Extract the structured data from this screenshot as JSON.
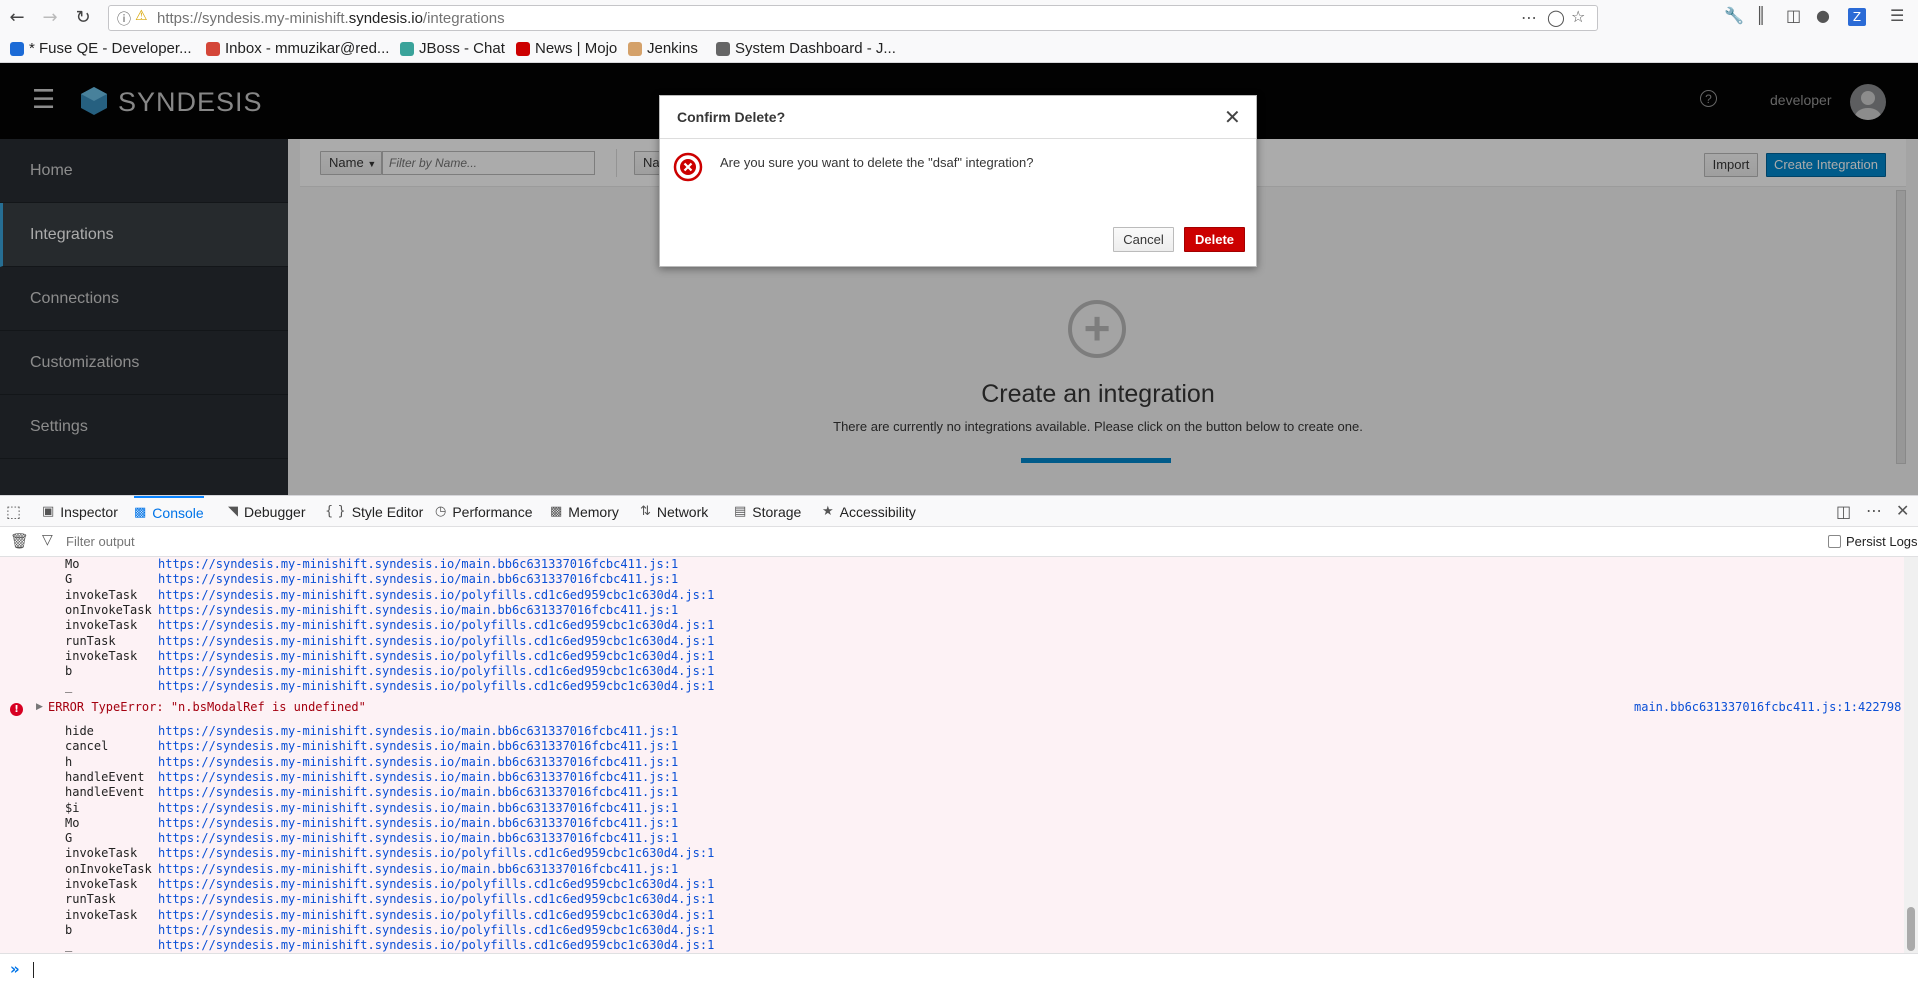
{
  "browser": {
    "url_prefix": "https://syndesis.my-minishift.",
    "url_domain": "syndesis.io",
    "url_path": "/integrations",
    "bookmarks": [
      {
        "label": "* Fuse QE - Developer...",
        "color": "#1c6bd6"
      },
      {
        "label": "Inbox - mmuzikar@red...",
        "color": "#d44638"
      },
      {
        "label": "JBoss - Chat",
        "color": "#3aa39a"
      },
      {
        "label": "News | Mojo",
        "color": "#cc0000"
      },
      {
        "label": "Jenkins",
        "color": "#d4a16a"
      },
      {
        "label": "System Dashboard - J...",
        "color": "#666666"
      }
    ]
  },
  "app": {
    "brand": "SYNDESIS",
    "user": "developer",
    "sidebar": [
      "Home",
      "Integrations",
      "Connections",
      "Customizations",
      "Settings"
    ],
    "active_item": "Integrations",
    "filter_select": "Name",
    "filter_placeholder": "Filter by Name...",
    "sort_select": "Na",
    "import_label": "Import",
    "create_label": "Create Integration",
    "empty_title": "Create an integration",
    "empty_text": "There are currently no integrations available. Please click on the button below to create one."
  },
  "modal": {
    "title": "Confirm Delete?",
    "message": "Are you sure you want to delete the \"dsaf\" integration?",
    "cancel_label": "Cancel",
    "delete_label": "Delete"
  },
  "devtools": {
    "tabs": [
      {
        "label": "Inspector",
        "icon": "inspector-icon"
      },
      {
        "label": "Console",
        "icon": "console-icon"
      },
      {
        "label": "Debugger",
        "icon": "debugger-icon"
      },
      {
        "label": "Style Editor",
        "icon": "style-editor-icon"
      },
      {
        "label": "Performance",
        "icon": "performance-icon"
      },
      {
        "label": "Memory",
        "icon": "memory-icon"
      },
      {
        "label": "Network",
        "icon": "network-icon"
      },
      {
        "label": "Storage",
        "icon": "storage-icon"
      },
      {
        "label": "Accessibility",
        "icon": "accessibility-icon"
      }
    ],
    "selected_tab": "Console",
    "filter_placeholder": "Filter output",
    "persist_logs_label": "Persist Logs",
    "stack_top": [
      {
        "fn": "Mo",
        "src": "https://syndesis.my-minishift.syndesis.io/main.bb6c631337016fcbc411.js:1"
      },
      {
        "fn": "G",
        "src": "https://syndesis.my-minishift.syndesis.io/main.bb6c631337016fcbc411.js:1"
      },
      {
        "fn": "invokeTask",
        "src": "https://syndesis.my-minishift.syndesis.io/polyfills.cd1c6ed959cbc1c630d4.js:1"
      },
      {
        "fn": "onInvokeTask",
        "src": "https://syndesis.my-minishift.syndesis.io/main.bb6c631337016fcbc411.js:1"
      },
      {
        "fn": "invokeTask",
        "src": "https://syndesis.my-minishift.syndesis.io/polyfills.cd1c6ed959cbc1c630d4.js:1"
      },
      {
        "fn": "runTask",
        "src": "https://syndesis.my-minishift.syndesis.io/polyfills.cd1c6ed959cbc1c630d4.js:1"
      },
      {
        "fn": "invokeTask",
        "src": "https://syndesis.my-minishift.syndesis.io/polyfills.cd1c6ed959cbc1c630d4.js:1"
      },
      {
        "fn": "b",
        "src": "https://syndesis.my-minishift.syndesis.io/polyfills.cd1c6ed959cbc1c630d4.js:1"
      },
      {
        "fn": "_",
        "src": "https://syndesis.my-minishift.syndesis.io/polyfills.cd1c6ed959cbc1c630d4.js:1"
      }
    ],
    "error_message": "ERROR TypeError: \"n.bsModalRef is undefined\"",
    "error_location": "main.bb6c631337016fcbc411.js:1:422798",
    "stack_error": [
      {
        "fn": "hide",
        "src": "https://syndesis.my-minishift.syndesis.io/main.bb6c631337016fcbc411.js:1"
      },
      {
        "fn": "cancel",
        "src": "https://syndesis.my-minishift.syndesis.io/main.bb6c631337016fcbc411.js:1"
      },
      {
        "fn": "h",
        "src": "https://syndesis.my-minishift.syndesis.io/main.bb6c631337016fcbc411.js:1"
      },
      {
        "fn": "handleEvent",
        "src": "https://syndesis.my-minishift.syndesis.io/main.bb6c631337016fcbc411.js:1"
      },
      {
        "fn": "handleEvent",
        "src": "https://syndesis.my-minishift.syndesis.io/main.bb6c631337016fcbc411.js:1"
      },
      {
        "fn": "$i",
        "src": "https://syndesis.my-minishift.syndesis.io/main.bb6c631337016fcbc411.js:1"
      },
      {
        "fn": "Mo",
        "src": "https://syndesis.my-minishift.syndesis.io/main.bb6c631337016fcbc411.js:1"
      },
      {
        "fn": "G",
        "src": "https://syndesis.my-minishift.syndesis.io/main.bb6c631337016fcbc411.js:1"
      },
      {
        "fn": "invokeTask",
        "src": "https://syndesis.my-minishift.syndesis.io/polyfills.cd1c6ed959cbc1c630d4.js:1"
      },
      {
        "fn": "onInvokeTask",
        "src": "https://syndesis.my-minishift.syndesis.io/main.bb6c631337016fcbc411.js:1"
      },
      {
        "fn": "invokeTask",
        "src": "https://syndesis.my-minishift.syndesis.io/polyfills.cd1c6ed959cbc1c630d4.js:1"
      },
      {
        "fn": "runTask",
        "src": "https://syndesis.my-minishift.syndesis.io/polyfills.cd1c6ed959cbc1c630d4.js:1"
      },
      {
        "fn": "invokeTask",
        "src": "https://syndesis.my-minishift.syndesis.io/polyfills.cd1c6ed959cbc1c630d4.js:1"
      },
      {
        "fn": "b",
        "src": "https://syndesis.my-minishift.syndesis.io/polyfills.cd1c6ed959cbc1c630d4.js:1"
      },
      {
        "fn": "_",
        "src": "https://syndesis.my-minishift.syndesis.io/polyfills.cd1c6ed959cbc1c630d4.js:1"
      }
    ]
  },
  "colors": {
    "brand_blue": "#0088ce",
    "danger_red": "#cc0000",
    "error_text": "#a4000f",
    "console_bg": "#fdf2f5",
    "header_bg": "#030303"
  }
}
